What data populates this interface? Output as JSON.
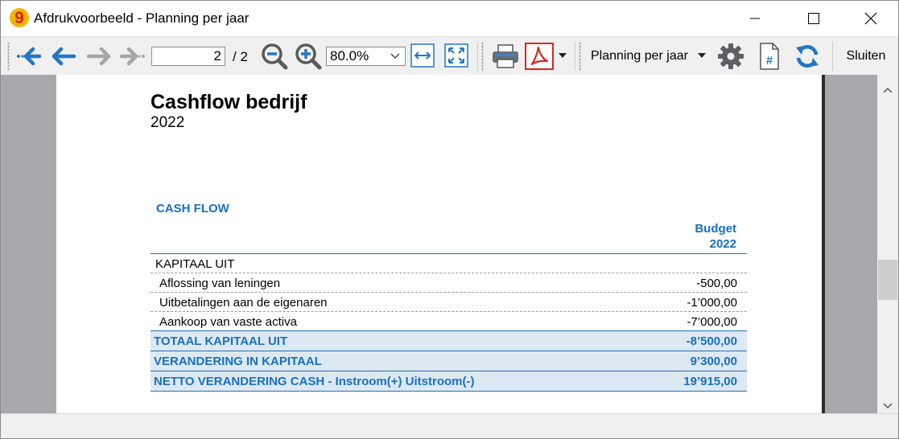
{
  "window": {
    "title": "Afdrukvoorbeeld - Planning per jaar",
    "app_icon_glyph": "9"
  },
  "toolbar": {
    "page_current": "2",
    "page_total": "/ 2",
    "zoom": "80.0%",
    "report_name": "Planning per jaar",
    "close_label": "Sluiten"
  },
  "report": {
    "title": "Cashflow bedrijf",
    "year": "2022",
    "section": "CASH FLOW",
    "column_header_line1": "Budget",
    "column_header_line2": "2022",
    "rows": [
      {
        "label": "KAPITAAL UIT",
        "value": ""
      },
      {
        "label": "Aflossing van leningen",
        "value": "-500,00"
      },
      {
        "label": "Uitbetalingen aan de eigenaren",
        "value": "-1’000,00"
      },
      {
        "label": "Aankoop van vaste activa",
        "value": "-7’000,00"
      },
      {
        "label": "TOTAAL KAPITAAL UIT",
        "value": "-8’500,00"
      },
      {
        "label": "VERANDERING IN KAPITAAL",
        "value": "9’300,00"
      },
      {
        "label": "NETTO VERANDERING CASH -  Instroom(+) Uitstroom(-)",
        "value": "19’915,00"
      }
    ]
  },
  "colors": {
    "accent_blue": "#1a6fbf",
    "total_row_bg": "#dce9f3",
    "viewer_bg": "#a9a9ad",
    "pdf_red": "#d9261c",
    "icon_blue": "#1a6fbf"
  }
}
